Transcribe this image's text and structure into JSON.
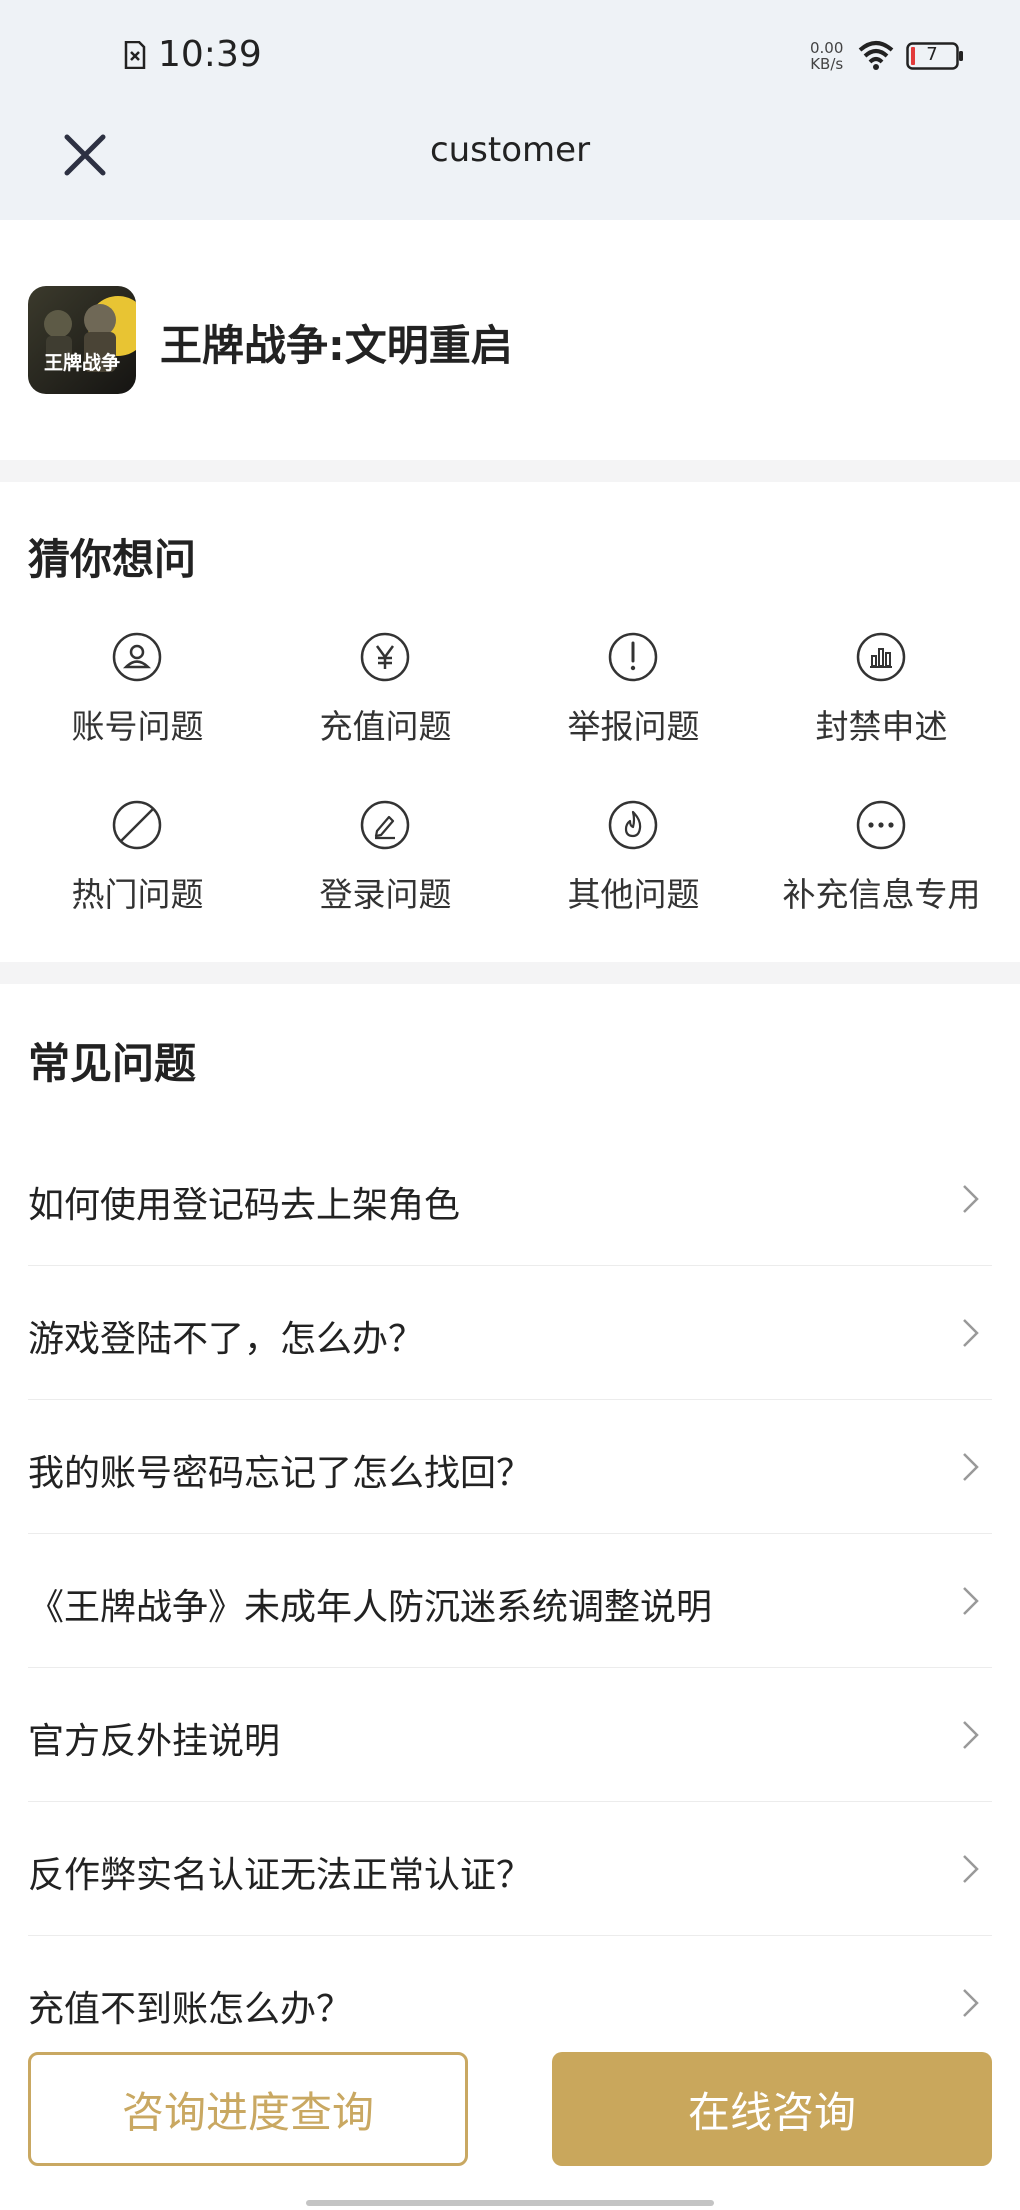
{
  "status_bar": {
    "time": "10:39",
    "net_speed_value": "0.00",
    "net_speed_unit": "KB/s",
    "battery_level": "7",
    "icons": [
      "sim-icon",
      "wifi-icon",
      "battery-icon"
    ]
  },
  "nav": {
    "title": "customer",
    "close_icon": "close-icon"
  },
  "game": {
    "name": "王牌战争:文明重启",
    "logo_text": "王牌战争"
  },
  "guess": {
    "title": "猜你想问",
    "categories": [
      {
        "label": "账号问题",
        "icon": "user-icon"
      },
      {
        "label": "充值问题",
        "icon": "yen-icon"
      },
      {
        "label": "举报问题",
        "icon": "alert-icon"
      },
      {
        "label": "封禁申述",
        "icon": "chart-icon"
      },
      {
        "label": "热门问题",
        "icon": "slash-icon"
      },
      {
        "label": "登录问题",
        "icon": "edit-icon"
      },
      {
        "label": "其他问题",
        "icon": "flame-icon"
      },
      {
        "label": "补充信息专用",
        "icon": "more-icon"
      }
    ]
  },
  "faq": {
    "title": "常见问题",
    "items": [
      "如何使用登记码去上架角色",
      "游戏登陆不了，怎么办？",
      "我的账号密码忘记了怎么找回？",
      "《王牌战争》未成年人防沉迷系统调整说明",
      "官方反外挂说明",
      "反作弊实名认证无法正常认证？",
      "充值不到账怎么办？"
    ]
  },
  "buttons": {
    "progress": "咨询进度查询",
    "online": "在线咨询"
  },
  "colors": {
    "accent": "#c9a75c",
    "header_bg": "#eef2f6",
    "battery_low": "#e23b3b"
  }
}
